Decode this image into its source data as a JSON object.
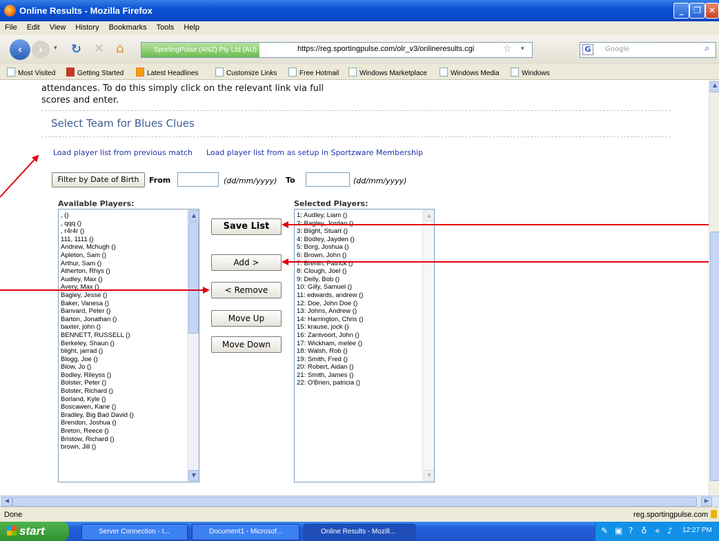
{
  "window": {
    "title": "Online Results - Mozilla Firefox"
  },
  "menu": [
    "File",
    "Edit",
    "View",
    "History",
    "Bookmarks",
    "Tools",
    "Help"
  ],
  "nav": {
    "site_identity": "SportingPulse (ANZ) Pty Ltd (AU)",
    "url": "https://reg.sportingpulse.com/olr_v3/onlineresults.cgi",
    "search_placeholder": "Google"
  },
  "bookmarks": [
    "Most Visited",
    "Getting Started",
    "Latest Headlines",
    "Customize Links",
    "Free Hotmail",
    "Windows Marketplace",
    "Windows Media",
    "Windows"
  ],
  "page": {
    "intro_line1": "attendances. To do this simply click on the relevant link via full",
    "intro_line2": "scores and enter.",
    "team_title": "Select Team for Blues Clues",
    "link_prev": "Load player list from previous match",
    "link_setup": "Load player list from as setup in Sportzware Membership",
    "filter_button": "Filter by Date of Birth",
    "from_label": "From",
    "to_label": "To",
    "date_hint": "(dd/mm/yyyy)",
    "available_label": "Available Players:",
    "selected_label": "Selected Players:",
    "buttons": {
      "save": "Save List",
      "add": "Add >",
      "remove": "< Remove",
      "move_up": "Move Up",
      "move_down": "Move Down"
    },
    "available_players": [
      ", ()",
      ", qqq ()",
      ", r4r4r ()",
      "111, 1111 ()",
      "Andrew, Mchugh ()",
      "Apleton, Sam ()",
      "Arthur, Sam ()",
      "Atherton, Rhys ()",
      "Audley, Max ()",
      "Avery, Max ()",
      "Bagley, Jesse ()",
      "Baker, Vanesa ()",
      "Banvard, Peter ()",
      "Barton, Jonathan ()",
      "baxter, john ()",
      "BENNETT, RUSSELL ()",
      "Berkeley, Shaun ()",
      "blight, jarrad ()",
      "Blogg, Joe ()",
      "Blow, Jo ()",
      "Bodley, Rileyss ()",
      "Bolster, Peter ()",
      "Bolster, Richard ()",
      "Borland, Kyle ()",
      "Boscawen, Kane ()",
      "Bradley, Big Bad David ()",
      "Brendon, Joshua ()",
      "Breton, Reece ()",
      "Bristow, Richard ()",
      "brown, Jill ()"
    ],
    "selected_players": [
      "1: Audley, Liam ()",
      "2: Bagley, Jordan ()",
      "3: Blight, Stuart ()",
      "4: Bodley, Jayden ()",
      "5: Borg, Joshua ()",
      "6: Brown, John ()",
      "7: Brenin, Patrick ()",
      "8: Clough, Joel ()",
      "9: Delly, Bob ()",
      "10: Gilly, Samuel ()",
      "11: edwards, andrew ()",
      "12: Doe, John Doe ()",
      "13: Johns, Andrew ()",
      "14: Harrington, Chris ()",
      "15: krause, jock ()",
      "16: Zantvoort, John ()",
      "17: Wickham, melee ()",
      "18: Walsh, Rob ()",
      "19: Smith, Fred ()",
      "20: Robert, Aidan ()",
      "21: Smith, James ()",
      "22: O'Brien, patricia ()"
    ]
  },
  "status": {
    "left": "Done",
    "right": "reg.sportingpulse.com"
  },
  "taskbar": {
    "start": "start",
    "tasks": [
      "Server Connection - t...",
      "Document1 - Microsof...",
      "Online Results - Mozill..."
    ],
    "clock": "12:27 PM"
  },
  "colors": {
    "annotation_arrow": "#e0000f",
    "link": "#2233aa",
    "title_blue": "#3b5d8f"
  }
}
